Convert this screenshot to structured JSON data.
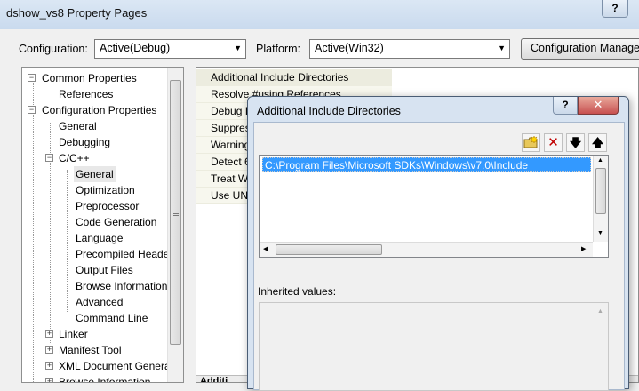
{
  "window": {
    "title": "dshow_vs8 Property Pages",
    "help_label": "?"
  },
  "config": {
    "configuration_label": "Configuration:",
    "configuration_value": "Active(Debug)",
    "platform_label": "Platform:",
    "platform_value": "Active(Win32)",
    "manager_button": "Configuration Manager..."
  },
  "tree": {
    "items": [
      {
        "label": "Common Properties",
        "expander": "−"
      },
      {
        "label": "References"
      },
      {
        "label": "Configuration Properties",
        "expander": "−"
      },
      {
        "label": "General"
      },
      {
        "label": "Debugging"
      },
      {
        "label": "C/C++",
        "expander": "−"
      },
      {
        "label": "General"
      },
      {
        "label": "Optimization"
      },
      {
        "label": "Preprocessor"
      },
      {
        "label": "Code Generation"
      },
      {
        "label": "Language"
      },
      {
        "label": "Precompiled Heade"
      },
      {
        "label": "Output Files"
      },
      {
        "label": "Browse Information"
      },
      {
        "label": "Advanced"
      },
      {
        "label": "Command Line"
      },
      {
        "label": "Linker",
        "expander": "+"
      },
      {
        "label": "Manifest Tool",
        "expander": "+"
      },
      {
        "label": "XML Document Genera",
        "expander": "+"
      },
      {
        "label": "Browse Information",
        "expander": "+"
      }
    ]
  },
  "grid": {
    "rows": [
      {
        "label": "Additional Include Directories"
      },
      {
        "label": "Resolve #using References"
      },
      {
        "label": "Debug I"
      },
      {
        "label": "Suppres"
      },
      {
        "label": "Warning"
      },
      {
        "label": "Detect 6"
      },
      {
        "label": "Treat W"
      },
      {
        "label": "Use UNI"
      }
    ],
    "bottom_label": "Additi"
  },
  "dialog": {
    "title": "Additional Include Directories",
    "help_label": "?",
    "close_label": "✕",
    "toolbar": {
      "new_line": "new-folder-icon",
      "delete": "delete-icon",
      "move_down": "arrow-down-icon",
      "move_up": "arrow-up-icon"
    },
    "list_items": [
      "C:\\Program Files\\Microsoft SDKs\\Windows\\v7.0\\Include"
    ],
    "inherited_label": "Inherited values:"
  }
}
